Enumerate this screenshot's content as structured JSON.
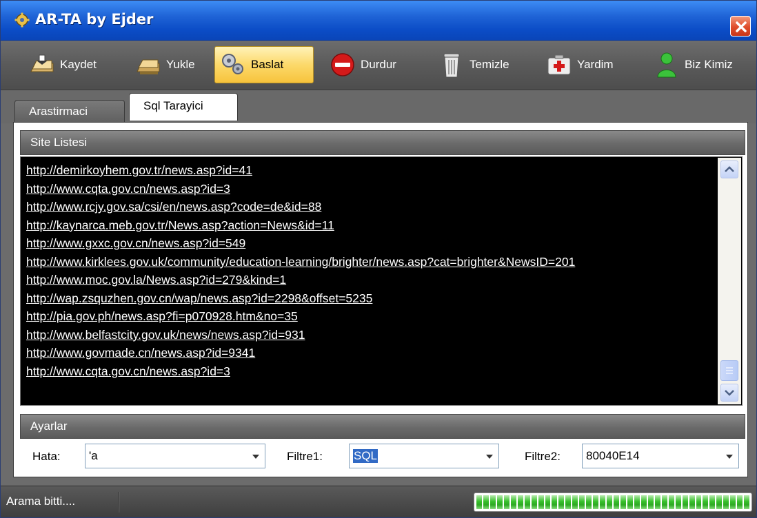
{
  "window": {
    "title": "AR-TA by Ejder"
  },
  "toolbar": {
    "buttons": [
      {
        "label": "Kaydet",
        "icon": "save-icon"
      },
      {
        "label": "Yukle",
        "icon": "load-icon"
      },
      {
        "label": "Baslat",
        "icon": "gears-icon",
        "active": true
      },
      {
        "label": "Durdur",
        "icon": "stop-icon"
      },
      {
        "label": "Temizle",
        "icon": "trash-icon"
      },
      {
        "label": "Yardim",
        "icon": "first-aid-icon"
      },
      {
        "label": "Biz Kimiz",
        "icon": "person-icon"
      }
    ]
  },
  "tabs": [
    {
      "label": "Arastirmaci",
      "selected": false
    },
    {
      "label": "Sql Tarayici",
      "selected": true
    }
  ],
  "site_list": {
    "header": "Site Listesi",
    "items": [
      "http://demirkoyhem.gov.tr/news.asp?id=41",
      "http://www.cqta.gov.cn/news.asp?id=3",
      "http://www.rcjy.gov.sa/csi/en/news.asp?code=de&id=88",
      "http://kaynarca.meb.gov.tr/News.asp?action=News&id=11",
      "http://www.gxxc.gov.cn/news.asp?id=549",
      "http://www.kirklees.gov.uk/community/education-learning/brighter/news.asp?cat=brighter&NewsID=201",
      "http://www.moc.gov.la/News.asp?id=279&kind=1",
      "http://wap.zsquzhen.gov.cn/wap/news.asp?id=2298&offset=5235",
      "http://pia.gov.ph/news.asp?fi=p070928.htm&no=35",
      "http://www.belfastcity.gov.uk/news/news.asp?id=931",
      "http://www.govmade.cn/news.asp?id=9341",
      "http://www.cqta.gov.cn/news.asp?id=3"
    ]
  },
  "settings": {
    "header": "Ayarlar",
    "hata_label": "Hata:",
    "hata_value": "'a",
    "filtre1_label": "Filtre1:",
    "filtre1_value": "SQL",
    "filtre2_label": "Filtre2:",
    "filtre2_value": "80040E14"
  },
  "status": {
    "text": "Arama bitti....",
    "progress": 1.0
  },
  "colors": {
    "titlebar": "#1f63d6",
    "active_button": "#fcd96a",
    "progress": "#37c02b"
  }
}
